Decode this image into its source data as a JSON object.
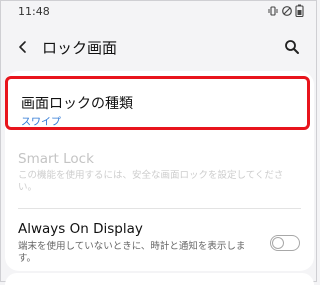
{
  "status_bar": {
    "time": "11:48",
    "icons": [
      "vibrate-icon",
      "dnd-icon",
      "battery-icon"
    ]
  },
  "header": {
    "title": "ロック画面",
    "back_icon": "chevron-left-icon",
    "search_icon": "search-icon"
  },
  "settings": {
    "lock_type": {
      "title": "画面ロックの種類",
      "value": "スワイプ",
      "highlight_color": "#e8141c",
      "value_color": "#2f79d6"
    },
    "smart_lock": {
      "title": "Smart Lock",
      "description": "この機能を使用するには、安全な画面ロックを設定してください。",
      "enabled": false
    },
    "always_on_display": {
      "title": "Always On Display",
      "description": "端末を使用していないときに、時計と通知を表示します。",
      "toggle_on": false
    }
  }
}
